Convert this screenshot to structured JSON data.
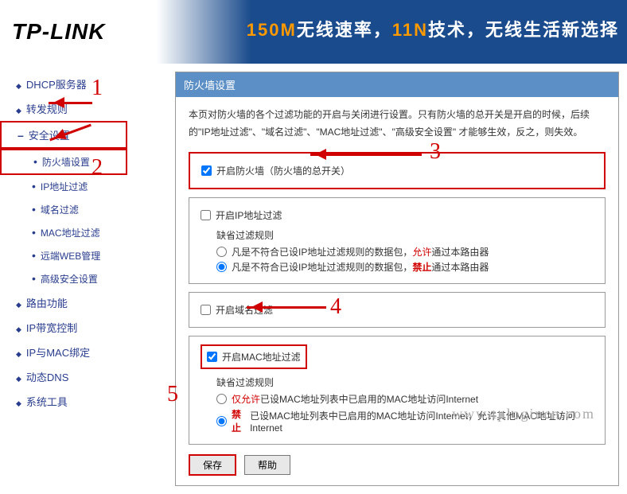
{
  "header": {
    "logo": "TP-LINK",
    "tagline_part1": "150M",
    "tagline_part2": "无线速率，",
    "tagline_part3": "11N",
    "tagline_part4": "技术，无线生活新选择"
  },
  "sidebar": {
    "items": [
      {
        "label": "DHCP服务器",
        "type": "top"
      },
      {
        "label": "转发规则",
        "type": "top"
      },
      {
        "label": "安全设置",
        "type": "expanded",
        "boxed": true
      },
      {
        "label": "防火墙设置",
        "type": "sub",
        "boxed": true
      },
      {
        "label": "IP地址过滤",
        "type": "sub"
      },
      {
        "label": "域名过滤",
        "type": "sub"
      },
      {
        "label": "MAC地址过滤",
        "type": "sub"
      },
      {
        "label": "远端WEB管理",
        "type": "sub"
      },
      {
        "label": "高级安全设置",
        "type": "sub"
      },
      {
        "label": "路由功能",
        "type": "top"
      },
      {
        "label": "IP带宽控制",
        "type": "top"
      },
      {
        "label": "IP与MAC绑定",
        "type": "top"
      },
      {
        "label": "动态DNS",
        "type": "top"
      },
      {
        "label": "系统工具",
        "type": "top"
      }
    ]
  },
  "panel": {
    "title": "防火墙设置",
    "description": "本页对防火墙的各个过滤功能的开启与关闭进行设置。只有防火墙的总开关是开启的时候，后续的\"IP地址过滤\"、\"域名过滤\"、\"MAC地址过滤\"、\"高级安全设置\" 才能够生效，反之，则失效。",
    "firewall_toggle": "开启防火墙（防火墙的总开关）",
    "ip_filter": {
      "toggle": "开启IP地址过滤",
      "rule_label": "缺省过滤规则",
      "rule1_pre": "凡是不符合已设IP地址过滤规则的数据包，",
      "rule1_key": "允许",
      "rule1_post": "通过本路由器",
      "rule2_pre": "凡是不符合已设IP地址过滤规则的数据包，",
      "rule2_key": "禁止",
      "rule2_post": "通过本路由器"
    },
    "domain_filter": {
      "toggle": "开启域名过滤"
    },
    "mac_filter": {
      "toggle": "开启MAC地址过滤",
      "rule_label": "缺省过滤规则",
      "rule1_key": "仅允许",
      "rule1_post": "已设MAC地址列表中已启用的MAC地址访问Internet",
      "rule2_key": "禁止",
      "rule2_post": "已设MAC地址列表中已启用的MAC地址访问Internet，允许其他MAC地址访问Internet"
    },
    "buttons": {
      "save": "保存",
      "help": "帮助"
    }
  },
  "annotations": {
    "n1": "1",
    "n2": "2",
    "n3": "3",
    "n4": "4",
    "n5": "5"
  },
  "watermark": "www.tplogincn.com"
}
